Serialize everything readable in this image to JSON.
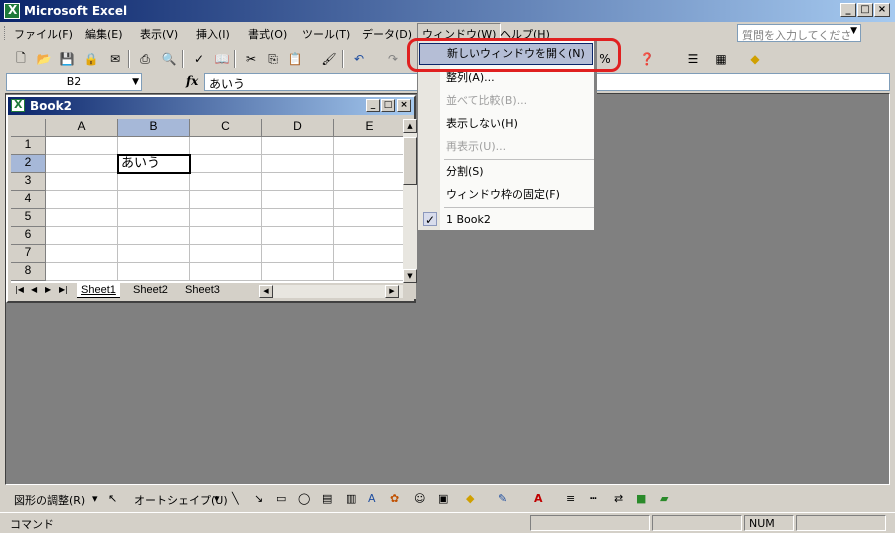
{
  "window": {
    "title": "Microsoft Excel"
  },
  "menubar": {
    "items": [
      "ファイル(F)",
      "編集(E)",
      "表示(V)",
      "挿入(I)",
      "書式(O)",
      "ツール(T)",
      "データ(D)",
      "ウィンドウ(W)",
      "ヘルプ(H)"
    ],
    "help_placeholder": "質問を入力してください"
  },
  "formula": {
    "cell": "B2",
    "fx": "fx",
    "value": "あいう"
  },
  "book": {
    "title": "Book2",
    "columns": [
      "A",
      "B",
      "C",
      "D",
      "E"
    ],
    "rows": [
      "1",
      "2",
      "3",
      "4",
      "5",
      "6",
      "7",
      "8"
    ],
    "active_value": "あいう",
    "sheets": [
      "Sheet1",
      "Sheet2",
      "Sheet3"
    ]
  },
  "dropdown": {
    "items": [
      {
        "label": "新しいウィンドウを開く(N)",
        "state": "highlighted"
      },
      {
        "label": "整列(A)...",
        "state": "enabled"
      },
      {
        "label": "並べて比較(B)...",
        "state": "disabled"
      },
      {
        "label": "表示しない(H)",
        "state": "enabled"
      },
      {
        "label": "再表示(U)...",
        "state": "disabled"
      },
      {
        "label": "分割(S)",
        "state": "enabled"
      },
      {
        "label": "ウィンドウ枠の固定(F)",
        "state": "enabled"
      },
      {
        "label": "1 Book2",
        "state": "checked"
      }
    ]
  },
  "drawbar": {
    "adjust_label": "図形の調整(R)",
    "autoshape_label": "オートシェイプ(U)"
  },
  "status": {
    "mode": "コマンド",
    "num": "NUM"
  },
  "colors": {
    "title_start": "#0a246a",
    "title_end": "#a6caf0",
    "highlight": "#b5bed6",
    "ring": "#e02020"
  }
}
